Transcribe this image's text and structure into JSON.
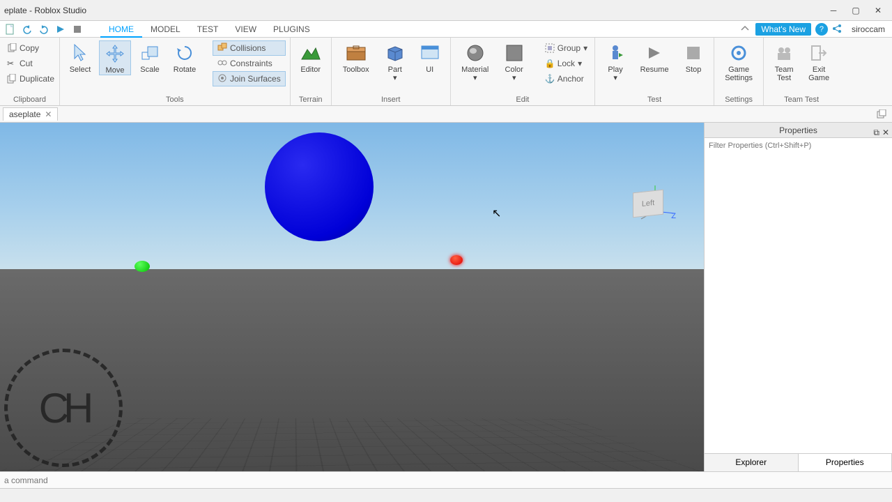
{
  "window": {
    "title": "eplate - Roblox Studio"
  },
  "qat": {
    "tabs": [
      "HOME",
      "MODEL",
      "TEST",
      "VIEW",
      "PLUGINS"
    ],
    "active": 0,
    "whats_new": "What's New",
    "username": "siroccam"
  },
  "ribbon": {
    "clipboard": {
      "copy": "Copy",
      "cut": "Cut",
      "duplicate": "Duplicate",
      "label": "Clipboard"
    },
    "tools": {
      "select": "Select",
      "move": "Move",
      "scale": "Scale",
      "rotate": "Rotate",
      "collisions": "Collisions",
      "constraints": "Constraints",
      "join": "Join Surfaces",
      "label": "Tools",
      "active": "Move"
    },
    "terrain": {
      "editor": "Editor",
      "label": "Terrain"
    },
    "insert": {
      "toolbox": "Toolbox",
      "part": "Part",
      "ui": "UI",
      "label": "Insert"
    },
    "edit": {
      "material": "Material",
      "color": "Color",
      "group": "Group",
      "lock": "Lock",
      "anchor": "Anchor",
      "label": "Edit"
    },
    "test": {
      "play": "Play",
      "resume": "Resume",
      "stop": "Stop",
      "label": "Test"
    },
    "settings": {
      "game": "Game\nSettings",
      "label": "Settings"
    },
    "teamtest": {
      "team": "Team\nTest",
      "exit": "Exit\nGame",
      "label": "Team Test"
    }
  },
  "doc_tab": {
    "name": "aseplate"
  },
  "viewport": {
    "axis_label": "Left",
    "axis_z": "Z",
    "logo": "CH"
  },
  "properties": {
    "title": "Properties",
    "filter_placeholder": "Filter Properties (Ctrl+Shift+P)",
    "tabs": [
      "Explorer",
      "Properties"
    ],
    "active_tab": 1
  },
  "command": {
    "placeholder": "a command"
  },
  "colors": {
    "accent": "#00a2ff",
    "blue": "#0000d8",
    "green": "#00c000",
    "red": "#e00000"
  }
}
